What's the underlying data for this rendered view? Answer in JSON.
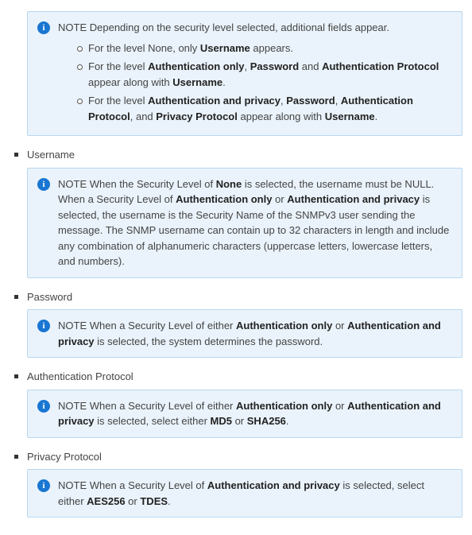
{
  "note1": {
    "prefix": "NOTE",
    "intro": " Depending on the security level selected, additional fields appear.",
    "bullets": [
      {
        "t0": "For the level None, only ",
        "b0": "Username",
        "t1": " appears."
      },
      {
        "t0": "For the level ",
        "b0": "Authentication only",
        "t1": ", ",
        "b1": "Password",
        "t2": " and ",
        "b2": "Authentication Protocol",
        "t3": " appear along with ",
        "b3": "Username",
        "t4": "."
      },
      {
        "t0": "For the level ",
        "b0": "Authentication and privacy",
        "t1": ", ",
        "b1": "Password",
        "t2": ", ",
        "b2": "Authentication Protocol",
        "t3": ", and ",
        "b3": "Privacy Protocol",
        "t4": " appear along with ",
        "b4": "Username",
        "t5": "."
      }
    ]
  },
  "fields": {
    "username": {
      "label": "Username",
      "note": {
        "prefix": "NOTE",
        "t0": " When the Security Level of ",
        "b0": "None",
        "t1": " is selected, the username must be NULL. When a Security Level of ",
        "b1": "Authentication only",
        "t2": " or ",
        "b2": "Authentication and privacy",
        "t3": " is selected, the username is the Security Name of the SNMPv3 user sending the message. The SNMP username can contain up to 32 characters in length and include any combination of alphanumeric characters (uppercase letters, lowercase letters, and numbers)."
      }
    },
    "password": {
      "label": "Password",
      "note": {
        "prefix": "NOTE",
        "t0": " When a Security Level of either ",
        "b0": "Authentication only",
        "t1": " or ",
        "b1": "Authentication and privacy",
        "t2": " is selected, the system determines the password."
      }
    },
    "auth_proto": {
      "label": "Authentication Protocol",
      "note": {
        "prefix": "NOTE",
        "t0": " When a Security Level of either ",
        "b0": "Authentication only",
        "t1": " or ",
        "b1": "Authentication and privacy",
        "t2": " is selected, select either ",
        "b2": "MD5",
        "t3": " or ",
        "b3": "SHA256",
        "t4": "."
      }
    },
    "priv_proto": {
      "label": "Privacy Protocol",
      "note": {
        "prefix": "NOTE",
        "t0": " When a Security Level of ",
        "b0": "Authentication and privacy",
        "t1": " is selected, select either ",
        "b1": "AES256",
        "t2": " or ",
        "b2": "TDES",
        "t3": "."
      }
    }
  }
}
